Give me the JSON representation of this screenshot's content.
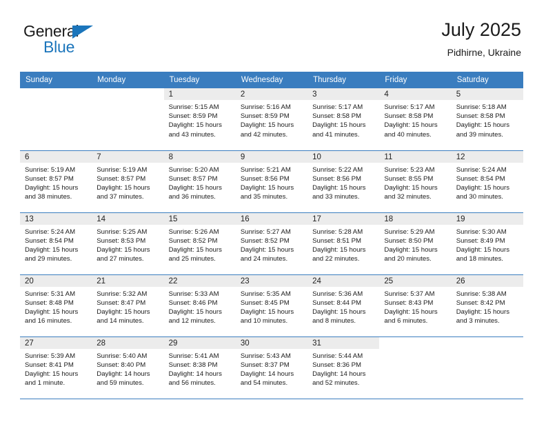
{
  "logo": {
    "word_one": "General",
    "word_two": "Blue",
    "triangle_color": "#1b75bb",
    "blue_color": "#1b75bb"
  },
  "header": {
    "title": "July 2025",
    "subtitle": "Pidhirne, Ukraine"
  },
  "theme": {
    "header_row_bg": "#3a7dbf",
    "daynum_bg": "#ececec",
    "grid_line": "#3a7dbf",
    "text": "#1a1a1a"
  },
  "calendar": {
    "weekday_headers": [
      "Sunday",
      "Monday",
      "Tuesday",
      "Wednesday",
      "Thursday",
      "Friday",
      "Saturday"
    ],
    "labels": {
      "sunrise_prefix": "Sunrise:",
      "sunset_prefix": "Sunset:",
      "daylight_prefix": "Daylight:"
    },
    "weeks": [
      [
        {
          "day": "",
          "sunrise": "",
          "sunset": "",
          "daylight_a": "",
          "daylight_b": "",
          "blank": true
        },
        {
          "day": "",
          "sunrise": "",
          "sunset": "",
          "daylight_a": "",
          "daylight_b": "",
          "blank": true
        },
        {
          "day": "1",
          "sunrise": "Sunrise: 5:15 AM",
          "sunset": "Sunset: 8:59 PM",
          "daylight_a": "Daylight: 15 hours",
          "daylight_b": "and 43 minutes."
        },
        {
          "day": "2",
          "sunrise": "Sunrise: 5:16 AM",
          "sunset": "Sunset: 8:59 PM",
          "daylight_a": "Daylight: 15 hours",
          "daylight_b": "and 42 minutes."
        },
        {
          "day": "3",
          "sunrise": "Sunrise: 5:17 AM",
          "sunset": "Sunset: 8:58 PM",
          "daylight_a": "Daylight: 15 hours",
          "daylight_b": "and 41 minutes."
        },
        {
          "day": "4",
          "sunrise": "Sunrise: 5:17 AM",
          "sunset": "Sunset: 8:58 PM",
          "daylight_a": "Daylight: 15 hours",
          "daylight_b": "and 40 minutes."
        },
        {
          "day": "5",
          "sunrise": "Sunrise: 5:18 AM",
          "sunset": "Sunset: 8:58 PM",
          "daylight_a": "Daylight: 15 hours",
          "daylight_b": "and 39 minutes."
        }
      ],
      [
        {
          "day": "6",
          "sunrise": "Sunrise: 5:19 AM",
          "sunset": "Sunset: 8:57 PM",
          "daylight_a": "Daylight: 15 hours",
          "daylight_b": "and 38 minutes."
        },
        {
          "day": "7",
          "sunrise": "Sunrise: 5:19 AM",
          "sunset": "Sunset: 8:57 PM",
          "daylight_a": "Daylight: 15 hours",
          "daylight_b": "and 37 minutes."
        },
        {
          "day": "8",
          "sunrise": "Sunrise: 5:20 AM",
          "sunset": "Sunset: 8:57 PM",
          "daylight_a": "Daylight: 15 hours",
          "daylight_b": "and 36 minutes."
        },
        {
          "day": "9",
          "sunrise": "Sunrise: 5:21 AM",
          "sunset": "Sunset: 8:56 PM",
          "daylight_a": "Daylight: 15 hours",
          "daylight_b": "and 35 minutes."
        },
        {
          "day": "10",
          "sunrise": "Sunrise: 5:22 AM",
          "sunset": "Sunset: 8:56 PM",
          "daylight_a": "Daylight: 15 hours",
          "daylight_b": "and 33 minutes."
        },
        {
          "day": "11",
          "sunrise": "Sunrise: 5:23 AM",
          "sunset": "Sunset: 8:55 PM",
          "daylight_a": "Daylight: 15 hours",
          "daylight_b": "and 32 minutes."
        },
        {
          "day": "12",
          "sunrise": "Sunrise: 5:24 AM",
          "sunset": "Sunset: 8:54 PM",
          "daylight_a": "Daylight: 15 hours",
          "daylight_b": "and 30 minutes."
        }
      ],
      [
        {
          "day": "13",
          "sunrise": "Sunrise: 5:24 AM",
          "sunset": "Sunset: 8:54 PM",
          "daylight_a": "Daylight: 15 hours",
          "daylight_b": "and 29 minutes."
        },
        {
          "day": "14",
          "sunrise": "Sunrise: 5:25 AM",
          "sunset": "Sunset: 8:53 PM",
          "daylight_a": "Daylight: 15 hours",
          "daylight_b": "and 27 minutes."
        },
        {
          "day": "15",
          "sunrise": "Sunrise: 5:26 AM",
          "sunset": "Sunset: 8:52 PM",
          "daylight_a": "Daylight: 15 hours",
          "daylight_b": "and 25 minutes."
        },
        {
          "day": "16",
          "sunrise": "Sunrise: 5:27 AM",
          "sunset": "Sunset: 8:52 PM",
          "daylight_a": "Daylight: 15 hours",
          "daylight_b": "and 24 minutes."
        },
        {
          "day": "17",
          "sunrise": "Sunrise: 5:28 AM",
          "sunset": "Sunset: 8:51 PM",
          "daylight_a": "Daylight: 15 hours",
          "daylight_b": "and 22 minutes."
        },
        {
          "day": "18",
          "sunrise": "Sunrise: 5:29 AM",
          "sunset": "Sunset: 8:50 PM",
          "daylight_a": "Daylight: 15 hours",
          "daylight_b": "and 20 minutes."
        },
        {
          "day": "19",
          "sunrise": "Sunrise: 5:30 AM",
          "sunset": "Sunset: 8:49 PM",
          "daylight_a": "Daylight: 15 hours",
          "daylight_b": "and 18 minutes."
        }
      ],
      [
        {
          "day": "20",
          "sunrise": "Sunrise: 5:31 AM",
          "sunset": "Sunset: 8:48 PM",
          "daylight_a": "Daylight: 15 hours",
          "daylight_b": "and 16 minutes."
        },
        {
          "day": "21",
          "sunrise": "Sunrise: 5:32 AM",
          "sunset": "Sunset: 8:47 PM",
          "daylight_a": "Daylight: 15 hours",
          "daylight_b": "and 14 minutes."
        },
        {
          "day": "22",
          "sunrise": "Sunrise: 5:33 AM",
          "sunset": "Sunset: 8:46 PM",
          "daylight_a": "Daylight: 15 hours",
          "daylight_b": "and 12 minutes."
        },
        {
          "day": "23",
          "sunrise": "Sunrise: 5:35 AM",
          "sunset": "Sunset: 8:45 PM",
          "daylight_a": "Daylight: 15 hours",
          "daylight_b": "and 10 minutes."
        },
        {
          "day": "24",
          "sunrise": "Sunrise: 5:36 AM",
          "sunset": "Sunset: 8:44 PM",
          "daylight_a": "Daylight: 15 hours",
          "daylight_b": "and 8 minutes."
        },
        {
          "day": "25",
          "sunrise": "Sunrise: 5:37 AM",
          "sunset": "Sunset: 8:43 PM",
          "daylight_a": "Daylight: 15 hours",
          "daylight_b": "and 6 minutes."
        },
        {
          "day": "26",
          "sunrise": "Sunrise: 5:38 AM",
          "sunset": "Sunset: 8:42 PM",
          "daylight_a": "Daylight: 15 hours",
          "daylight_b": "and 3 minutes."
        }
      ],
      [
        {
          "day": "27",
          "sunrise": "Sunrise: 5:39 AM",
          "sunset": "Sunset: 8:41 PM",
          "daylight_a": "Daylight: 15 hours",
          "daylight_b": "and 1 minute."
        },
        {
          "day": "28",
          "sunrise": "Sunrise: 5:40 AM",
          "sunset": "Sunset: 8:40 PM",
          "daylight_a": "Daylight: 14 hours",
          "daylight_b": "and 59 minutes."
        },
        {
          "day": "29",
          "sunrise": "Sunrise: 5:41 AM",
          "sunset": "Sunset: 8:38 PM",
          "daylight_a": "Daylight: 14 hours",
          "daylight_b": "and 56 minutes."
        },
        {
          "day": "30",
          "sunrise": "Sunrise: 5:43 AM",
          "sunset": "Sunset: 8:37 PM",
          "daylight_a": "Daylight: 14 hours",
          "daylight_b": "and 54 minutes."
        },
        {
          "day": "31",
          "sunrise": "Sunrise: 5:44 AM",
          "sunset": "Sunset: 8:36 PM",
          "daylight_a": "Daylight: 14 hours",
          "daylight_b": "and 52 minutes."
        },
        {
          "day": "",
          "sunrise": "",
          "sunset": "",
          "daylight_a": "",
          "daylight_b": "",
          "blank": true
        },
        {
          "day": "",
          "sunrise": "",
          "sunset": "",
          "daylight_a": "",
          "daylight_b": "",
          "blank": true
        }
      ]
    ]
  }
}
